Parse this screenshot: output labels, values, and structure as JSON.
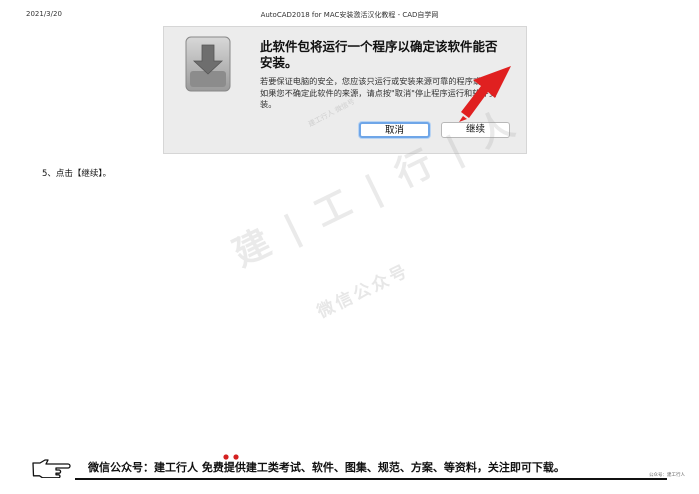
{
  "header": {
    "date": "2021/3/20",
    "title": "AutoCAD2018 for MAC安装激活汉化教程 - CAD自学网"
  },
  "dialog": {
    "icon": "installer-package-icon",
    "title": "此软件包将运行一个程序以确定该软件能否安装。",
    "body": "若要保证电脑的安全，您应该只运行或安装来源可靠的程序或软件。如果您不确定此软件的来源，请点按\"取消\"停止程序运行和软件安装。",
    "cancel_label": "取消",
    "continue_label": "继续",
    "accent_color": "#6fa6e8",
    "arrow_color": "#e02020"
  },
  "step": {
    "text": "5、点击【继续】。"
  },
  "watermark": {
    "main": "建 | 工 | 行 | 人",
    "sub": "微信公众号",
    "small": "建工行人 微信号"
  },
  "footer": {
    "icon": "pointing-hand-icon",
    "text": "微信公众号：建工行人  免费提供建工类考试、软件、图集、规范、方案、等资料，关注即可下载。",
    "corner": "公众号：建工行人"
  }
}
